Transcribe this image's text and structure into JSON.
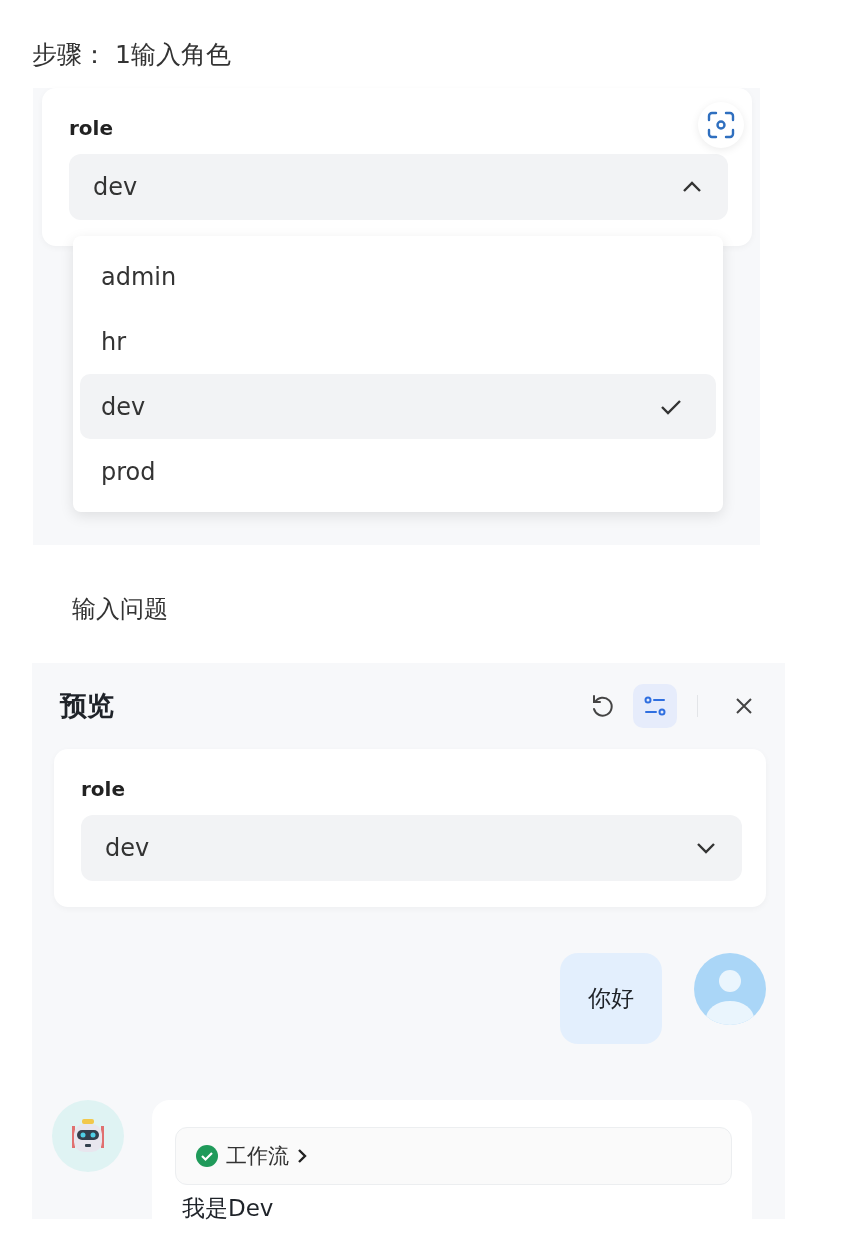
{
  "step": {
    "text": "步骤： 1输入角色"
  },
  "role_form": {
    "label": "role",
    "value": "dev",
    "expanded": true,
    "options": [
      {
        "label": "admin",
        "selected": false
      },
      {
        "label": "hr",
        "selected": false
      },
      {
        "label": "dev",
        "selected": true
      },
      {
        "label": "prod",
        "selected": false
      }
    ]
  },
  "question_caption": "输入问题",
  "preview": {
    "title": "预览",
    "settings_active": true,
    "form": {
      "label": "role",
      "value": "dev",
      "expanded": false
    },
    "messages": [
      {
        "kind": "user",
        "text": "你好"
      },
      {
        "kind": "bot",
        "workflow": {
          "label": "工作流",
          "succeeded": true
        },
        "text": "我是Dev"
      }
    ]
  }
}
